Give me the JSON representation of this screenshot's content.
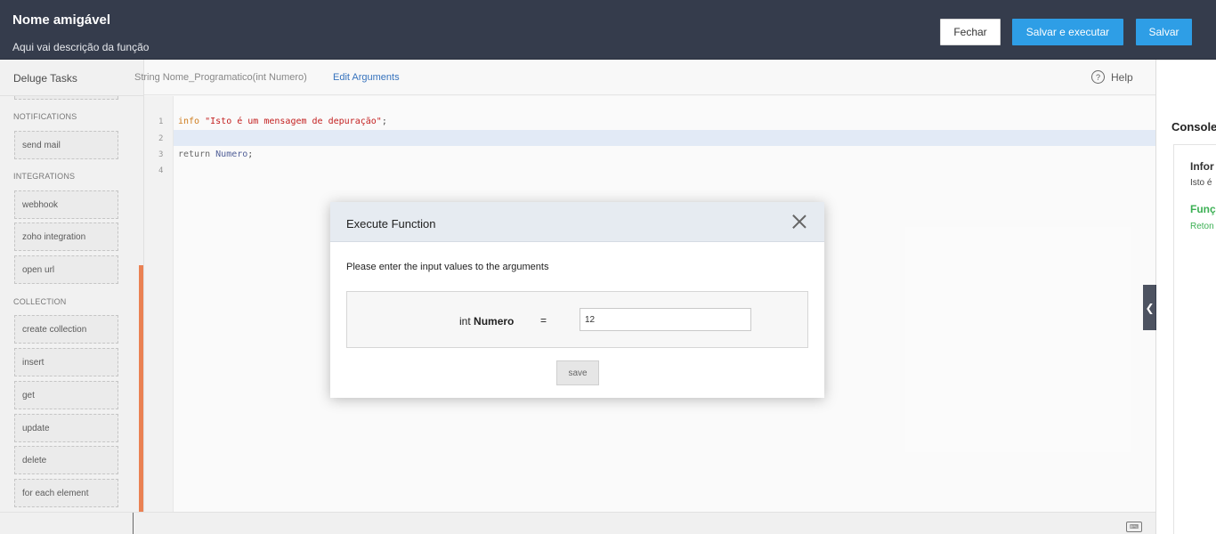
{
  "header": {
    "title": "Nome amigável",
    "description": "Aqui vai descrição da função",
    "close_label": "Fechar",
    "save_run_label": "Salvar e executar",
    "save_label": "Salvar"
  },
  "sidebar": {
    "title": "Deluge Tasks",
    "sections": [
      {
        "label": "NOTIFICATIONS",
        "items": [
          "send mail"
        ]
      },
      {
        "label": "INTEGRATIONS",
        "items": [
          "webhook",
          "zoho integration",
          "open url"
        ]
      },
      {
        "label": "COLLECTION",
        "items": [
          "create collection",
          "insert",
          "get",
          "update",
          "delete",
          "for each element"
        ]
      }
    ]
  },
  "toolbar": {
    "signature": "String  Nome_Programatico(int Numero)",
    "edit_arguments": "Edit Arguments",
    "help": "Help",
    "help_icon": "?"
  },
  "editor": {
    "line_numbers": [
      "1",
      "2",
      "3",
      "4"
    ],
    "line1_keyword": "info",
    "line1_string": "\"Isto é um mensagem de depuração\"",
    "line1_end": ";",
    "line3_keyword": "return",
    "line3_var": "Numero",
    "line3_end": ";"
  },
  "console": {
    "title": "Console",
    "info_title": "Infor",
    "info_message": "Isto é",
    "function_title": "Funç",
    "return_label": "Reton"
  },
  "modal": {
    "title": "Execute Function",
    "prompt": "Please enter the input values to the arguments",
    "arg_type": "int",
    "arg_name": "Numero",
    "equals": "=",
    "arg_value": "12",
    "save_label": "save"
  },
  "icons": {
    "close": "close-icon",
    "help": "help-icon",
    "collapse": "chevron-left-icon",
    "keyboard": "keyboard-icon"
  }
}
